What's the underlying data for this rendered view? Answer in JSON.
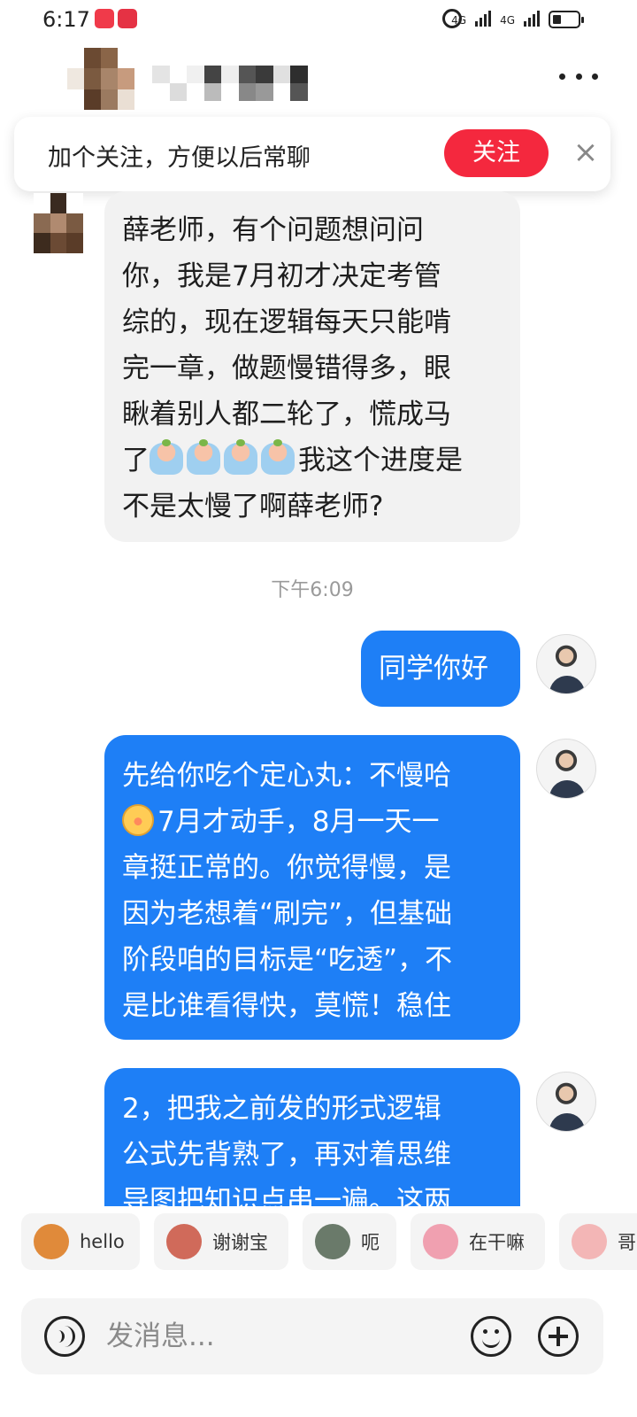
{
  "status_bar": {
    "time": "6:17",
    "signal_1": "4G",
    "signal_2": "4G"
  },
  "header": {
    "contact_name": "",
    "more_icon": "more-icon"
  },
  "follow_banner": {
    "text": "加个关注，方便以后常聊",
    "button": "关注",
    "close": "×"
  },
  "messages": [
    {
      "side": "in",
      "lines": [
        "薛老师，有个问题想问问",
        "你，我是7月初才决定考管",
        "综的，现在逻辑每天只能啃",
        "完一章，做题慢错得多，眼",
        "瞅着别人都二轮了，慌成马",
        "了",
        "我这个进度是",
        "不是太慢了啊薛老师?"
      ]
    },
    {
      "side": "timestamp",
      "text": "下午6:09"
    },
    {
      "side": "out",
      "lines": [
        "同学你好"
      ]
    },
    {
      "side": "out",
      "lines": [
        "先给你吃个定心丸：不慢哈",
        "7月才动手，8月一天一",
        "章挺正常的。你觉得慢，是",
        "因为老想着“刷完”，但基础",
        "阶段咱的目标是“吃透”，不",
        "是比谁看得快，莫慌！稳住"
      ]
    },
    {
      "side": "out",
      "lines": [
        "2，把我之前发的形式逻辑",
        "公式先背熟了，再对着思维",
        "导图把知识点串一遍。这两"
      ]
    }
  ],
  "stickers": [
    {
      "label": "hello",
      "color": "#e08a3a"
    },
    {
      "label": "谢谢宝",
      "color": "#d06a5a"
    },
    {
      "label": "呃",
      "color": "#6a7a6a"
    },
    {
      "label": "在干嘛",
      "color": "#f0a0b0"
    },
    {
      "label": "哥",
      "color": "#f3b6b6"
    }
  ],
  "input": {
    "placeholder": "发消息..."
  },
  "colors": {
    "accent_blue": "#1e7ff6",
    "follow_red": "#f4283e"
  }
}
